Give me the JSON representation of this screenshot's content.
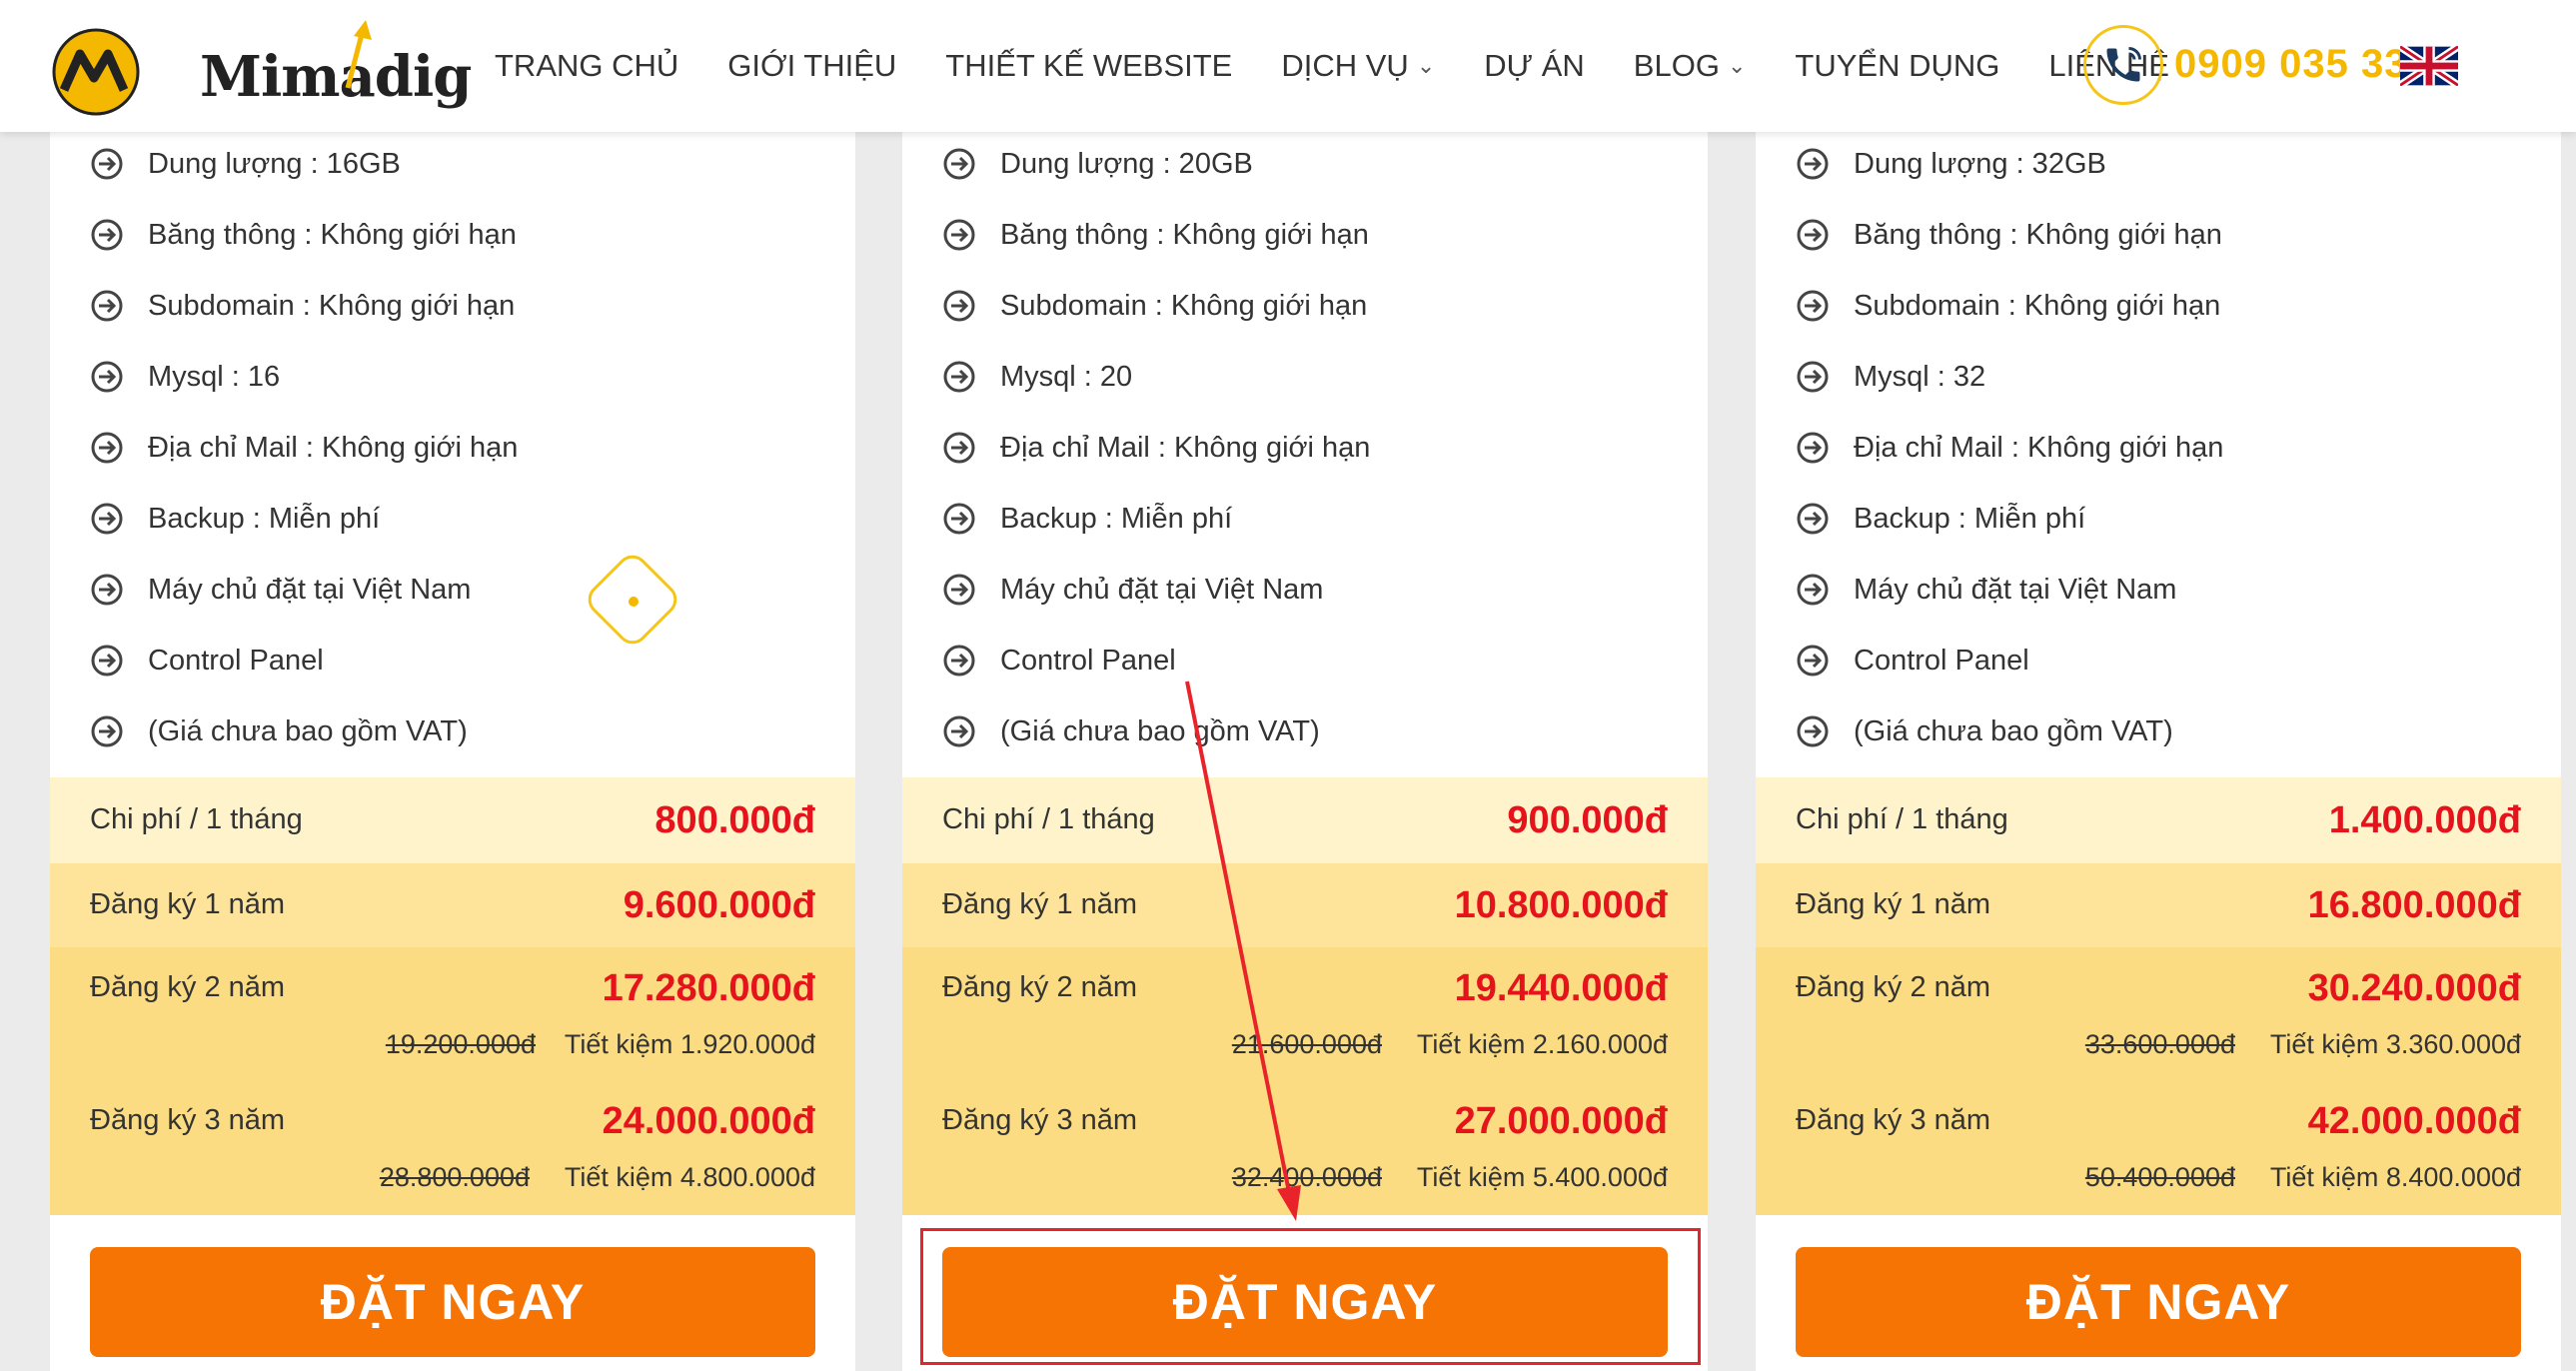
{
  "header": {
    "logo_text": "Mimadig",
    "nav": [
      {
        "label": "TRANG CHỦ",
        "dropdown": false
      },
      {
        "label": "GIỚI THIỆU",
        "dropdown": false
      },
      {
        "label": "THIẾT KẾ WEBSITE",
        "dropdown": false
      },
      {
        "label": "DỊCH VỤ",
        "dropdown": true
      },
      {
        "label": "DỰ ÁN",
        "dropdown": false
      },
      {
        "label": "BLOG",
        "dropdown": true
      },
      {
        "label": "TUYỂN DỤNG",
        "dropdown": false
      },
      {
        "label": "LIÊN HỆ",
        "dropdown": false
      }
    ],
    "phone": "0909 035 333",
    "accent_color": "#f5b800"
  },
  "cards": [
    {
      "features": [
        "Dung lượng : 16GB",
        "Băng thông : Không giới hạn",
        "Subdomain : Không giới hạn",
        "Mysql : 16",
        "Địa chỉ Mail : Không giới hạn",
        "Backup : Miễn phí",
        "Máy chủ đặt tại Việt Nam",
        "Control Panel",
        "(Giá chưa bao gồm VAT)"
      ],
      "monthly_label": "Chi phí / 1 tháng",
      "monthly_price": "800.000đ",
      "year1_label": "Đăng ký 1 năm",
      "year1_price": "9.600.000đ",
      "year2_label": "Đăng ký 2 năm",
      "year2_price": "17.280.000đ",
      "year2_old": "19.200.000đ",
      "year2_save": "Tiết kiệm 1.920.000đ",
      "year3_label": "Đăng ký 3 năm",
      "year3_price": "24.000.000đ",
      "year3_old": "28.800.000đ",
      "year3_save": "Tiết kiệm 4.800.000đ",
      "button_label": "ĐẶT NGAY"
    },
    {
      "features": [
        "Dung lượng : 20GB",
        "Băng thông : Không giới hạn",
        "Subdomain : Không giới hạn",
        "Mysql : 20",
        "Địa chỉ Mail : Không giới hạn",
        "Backup : Miễn phí",
        "Máy chủ đặt tại Việt Nam",
        "Control Panel",
        "(Giá chưa bao gồm VAT)"
      ],
      "monthly_label": "Chi phí / 1 tháng",
      "monthly_price": "900.000đ",
      "year1_label": "Đăng ký 1 năm",
      "year1_price": "10.800.000đ",
      "year2_label": "Đăng ký 2 năm",
      "year2_price": "19.440.000đ",
      "year2_old": "21.600.000đ",
      "year2_save": "Tiết kiệm 2.160.000đ",
      "year3_label": "Đăng ký 3 năm",
      "year3_price": "27.000.000đ",
      "year3_old": "32.400.000đ",
      "year3_save": "Tiết kiệm 5.400.000đ",
      "button_label": "ĐẶT NGAY"
    },
    {
      "features": [
        "Dung lượng : 32GB",
        "Băng thông : Không giới hạn",
        "Subdomain : Không giới hạn",
        "Mysql : 32",
        "Địa chỉ Mail : Không giới hạn",
        "Backup : Miễn phí",
        "Máy chủ đặt tại Việt Nam",
        "Control Panel",
        "(Giá chưa bao gồm VAT)"
      ],
      "monthly_label": "Chi phí / 1 tháng",
      "monthly_price": "1.400.000đ",
      "year1_label": "Đăng ký 1 năm",
      "year1_price": "16.800.000đ",
      "year2_label": "Đăng ký 2 năm",
      "year2_price": "30.240.000đ",
      "year2_old": "33.600.000đ",
      "year2_save": "Tiết kiệm 3.360.000đ",
      "year3_label": "Đăng ký 3 năm",
      "year3_price": "42.000.000đ",
      "year3_old": "50.400.000đ",
      "year3_save": "Tiết kiệm 8.400.000đ",
      "button_label": "ĐẶT NGAY"
    }
  ],
  "colors": {
    "button": "#f57404",
    "price": "#e5131c",
    "annotation": "#e8232a"
  }
}
